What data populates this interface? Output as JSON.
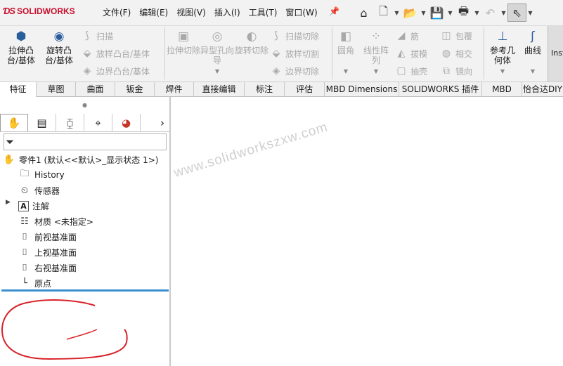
{
  "app": {
    "brand": "SOLIDWORKS"
  },
  "menu": [
    "文件(F)",
    "编辑(E)",
    "视图(V)",
    "插入(I)",
    "工具(T)",
    "窗口(W)"
  ],
  "ribbon": {
    "extrude_boss": "拉伸凸台/基体",
    "revolve_boss": "旋转凸台/基体",
    "sweep": "扫描",
    "loft_boss": "放样凸台/基体",
    "boundary_boss": "边界凸台/基体",
    "extrude_cut": "拉伸切除",
    "hole_wizard": "异型孔向导",
    "revolve_cut": "旋转切除",
    "sweep_cut": "扫描切除",
    "loft_cut": "放样切割",
    "boundary_cut": "边界切除",
    "fillet": "圆角",
    "linear_pattern": "线性阵列",
    "rib": "筋",
    "draft": "拔模",
    "shell": "抽壳",
    "wrap": "包覆",
    "intersect": "相交",
    "mirror": "镜向",
    "ref_geometry": "参考几何体",
    "curves": "曲线",
    "instant3d": "Inst"
  },
  "tabs": [
    "特征",
    "草图",
    "曲面",
    "钣金",
    "焊件",
    "直接编辑",
    "标注",
    "评估",
    "MBD Dimensions",
    "SOLIDWORKS 插件",
    "MBD",
    "怡合达DIY"
  ],
  "tree": {
    "root": "零件1 (默认<<默认>_显示状态 1>)",
    "history": "History",
    "sensors": "传感器",
    "annotations": "注解",
    "material": "材质 <未指定>",
    "front_plane": "前视基准面",
    "top_plane": "上视基准面",
    "right_plane": "右视基准面",
    "origin": "原点"
  },
  "watermark": "www.solidworkszxw.com",
  "colors": {
    "brand_red": "#c8102e",
    "rollback_bar": "#3b8fd0",
    "annotation_red": "#d8232a"
  }
}
